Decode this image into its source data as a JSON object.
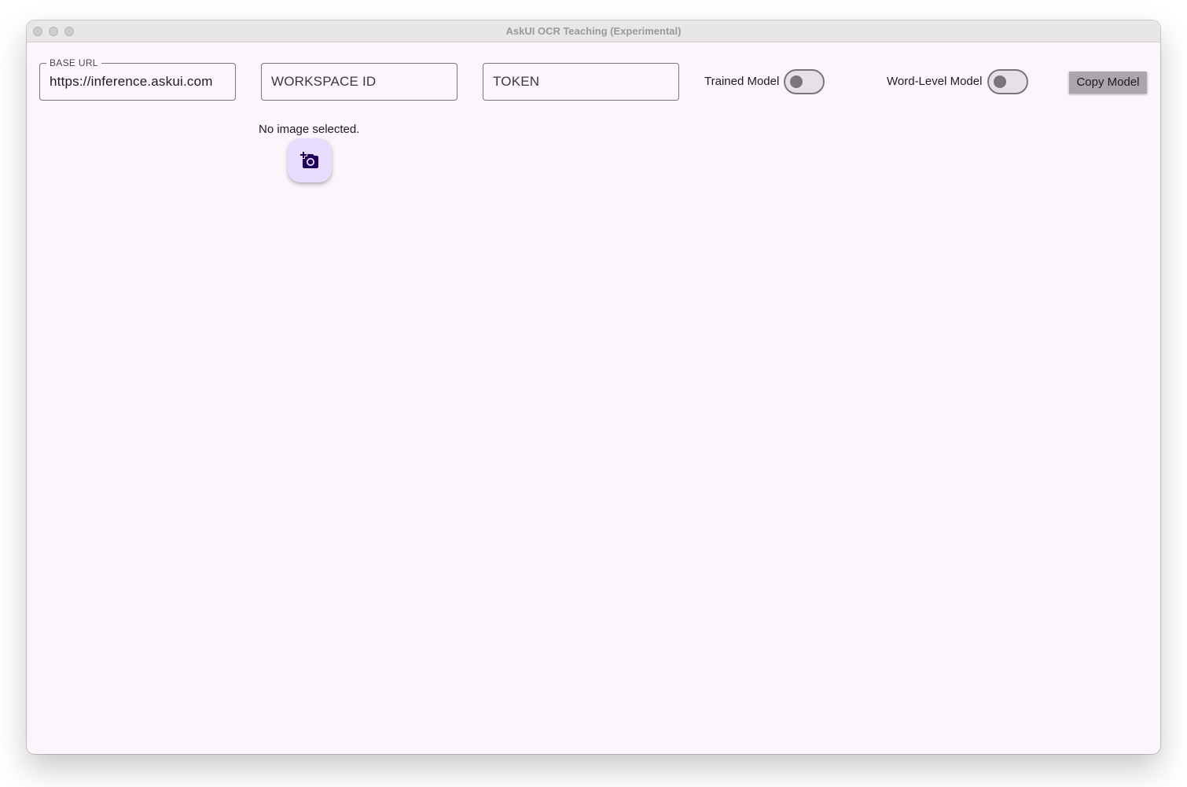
{
  "window": {
    "title": "AskUI OCR Teaching (Experimental)"
  },
  "form": {
    "base_url": {
      "label": "BASE URL",
      "value": "https://inference.askui.com"
    },
    "workspace_id": {
      "placeholder": "WORKSPACE ID"
    },
    "token": {
      "placeholder": "TOKEN"
    }
  },
  "toggles": {
    "trained_model": {
      "label": "Trained Model",
      "on": false
    },
    "word_level_model": {
      "label": "Word-Level Model",
      "on": false
    }
  },
  "actions": {
    "copy_model_label": "Copy Model",
    "add_image_icon": "add-a-photo-icon"
  },
  "status": {
    "image_message": "No image selected."
  },
  "colors": {
    "background": "#fcf6fc",
    "fab_background": "#e9ddff",
    "fab_icon": "#21005d",
    "outline": "#79747e",
    "button_gray": "#aba6ab"
  }
}
